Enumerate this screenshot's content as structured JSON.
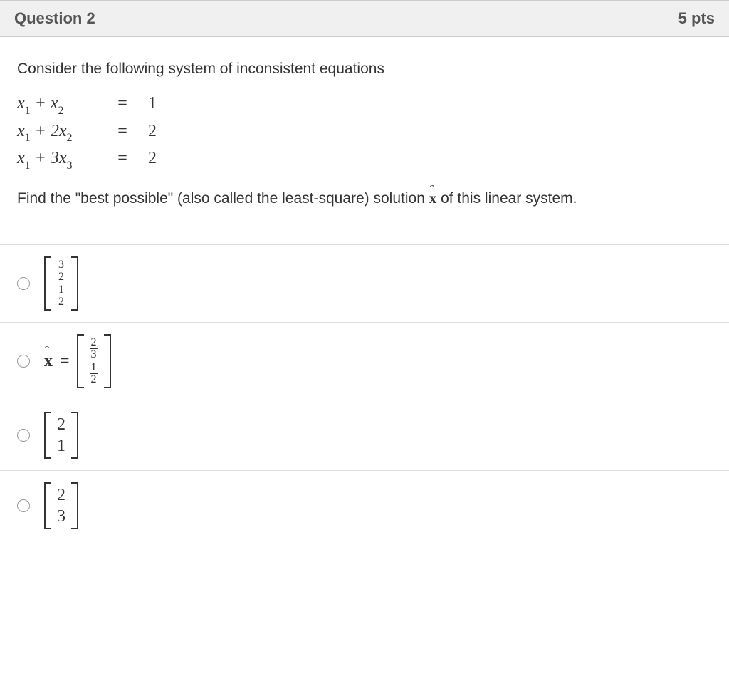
{
  "header": {
    "title": "Question 2",
    "points": "5 pts"
  },
  "prompt": {
    "intro": "Consider the following system of inconsistent equations",
    "equations": [
      {
        "lhs_pre": "x",
        "s1": "1",
        "mid": " + x",
        "s2": "2",
        "rhs": "1"
      },
      {
        "lhs_pre": "x",
        "s1": "1",
        "mid": " + 2x",
        "s2": "2",
        "rhs": "2"
      },
      {
        "lhs_pre": "x",
        "s1": "1",
        "mid": " + 3x",
        "s2": "3",
        "rhs": "2"
      }
    ],
    "eq_sign": "=",
    "ask_pre": "Find the \"best possible\" (also called the least-square) solution ",
    "ask_post": " of this linear system."
  },
  "options": {
    "a": {
      "n1": "3",
      "d1": "2",
      "n2": "1",
      "d2": "2"
    },
    "b": {
      "prefix_x": "x",
      "eq": "=",
      "n1": "2",
      "d1": "3",
      "n2": "1",
      "d2": "2"
    },
    "c": {
      "v1": "2",
      "v2": "1"
    },
    "d": {
      "v1": "2",
      "v2": "3"
    }
  }
}
